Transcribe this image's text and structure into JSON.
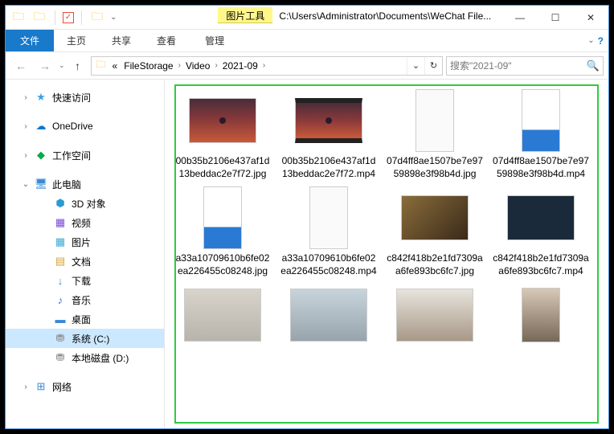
{
  "title": "C:\\Users\\Administrator\\Documents\\WeChat File...",
  "context_tab": "图片工具",
  "ribbon": {
    "file": "文件",
    "tabs": [
      "主页",
      "共享",
      "查看"
    ],
    "manage": "管理"
  },
  "breadcrumbs": [
    "FileStorage",
    "Video",
    "2021-09"
  ],
  "search_placeholder": "搜索\"2021-09\"",
  "sidebar": {
    "quick": "快速访问",
    "onedrive": "OneDrive",
    "workspace": "工作空间",
    "thispc": "此电脑",
    "children": {
      "obj3d": "3D 对象",
      "video": "视频",
      "pictures": "图片",
      "documents": "文档",
      "downloads": "下载",
      "music": "音乐",
      "desktop": "桌面",
      "drive_c": "系统 (C:)",
      "drive_d": "本地磁盘 (D:)"
    },
    "network": "网络"
  },
  "files": [
    {
      "name": "00b35b2106e437af1d13beddac2e7f72.jpg",
      "thumb": "sunset"
    },
    {
      "name": "00b35b2106e437af1d13beddac2e7f72.mp4",
      "thumb": "sunset-film"
    },
    {
      "name": "07d4ff8ae1507be7e9759898e3f98b4d.jpg",
      "thumb": "tall-white"
    },
    {
      "name": "07d4ff8ae1507be7e9759898e3f98b4d.mp4",
      "thumb": "tall-blue"
    },
    {
      "name": "a33a10709610b6fe02ea226455c08248.jpg",
      "thumb": "tall-blue"
    },
    {
      "name": "a33a10709610b6fe02ea226455c08248.mp4",
      "thumb": "tall-white"
    },
    {
      "name": "c842f418b2e1fd7309aa6fe893bc6fc7.jpg",
      "thumb": "wide-brown"
    },
    {
      "name": "c842f418b2e1fd7309aa6fe893bc6fc7.mp4",
      "thumb": "wide-dark"
    },
    {
      "name": "",
      "thumb": "laptop"
    },
    {
      "name": "",
      "thumb": "phone"
    },
    {
      "name": "",
      "thumb": "cat"
    },
    {
      "name": "",
      "thumb": "man"
    }
  ]
}
